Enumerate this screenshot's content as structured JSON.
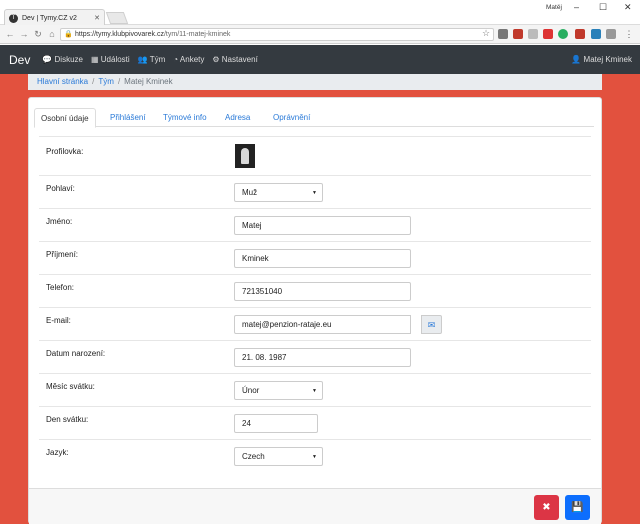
{
  "browser": {
    "tab_title": "Dev | Tymy.CZ v2",
    "user": "Matěj",
    "url_host": "https://tymy.klubpivovarek.cz",
    "url_path": "/tym/11-matej-kminek"
  },
  "navbar": {
    "brand": "Dev",
    "items": [
      {
        "icon": "comments-icon",
        "label": "Diskuze"
      },
      {
        "icon": "calendar-icon",
        "label": "Události"
      },
      {
        "icon": "users-icon",
        "label": "Tým"
      },
      {
        "icon": "pie-chart-icon",
        "label": "Ankety"
      },
      {
        "icon": "gears-icon",
        "label": "Nastavení"
      }
    ],
    "user": "Matej Kminek"
  },
  "breadcrumb": {
    "home": "Hlavní stránka",
    "team": "Tým",
    "current": "Matej Kminek"
  },
  "tabs": [
    "Osobní údaje",
    "Přihlášení",
    "Týmové info",
    "Adresa",
    "Oprávnění"
  ],
  "form": {
    "avatar_label": "Profilovka:",
    "gender_label": "Pohlaví:",
    "gender_value": "Muž",
    "first_name_label": "Jméno:",
    "first_name_value": "Matej",
    "last_name_label": "Příjmení:",
    "last_name_value": "Kminek",
    "phone_label": "Telefon:",
    "phone_value": "721351040",
    "email_label": "E-mail:",
    "email_value": "matej@penzion-rataje.eu",
    "birth_label": "Datum narození:",
    "birth_value": "21. 08. 1987",
    "nameday_month_label": "Měsíc svátku:",
    "nameday_month_value": "Únor",
    "nameday_day_label": "Den svátku:",
    "nameday_day_value": "24",
    "language_label": "Jazyk:",
    "language_value": "Czech"
  },
  "colors": {
    "accent": "#e2513e",
    "navbar": "#343a40",
    "link": "#2a7ad8",
    "delete": "#dc3545",
    "save": "#0d6efd"
  }
}
